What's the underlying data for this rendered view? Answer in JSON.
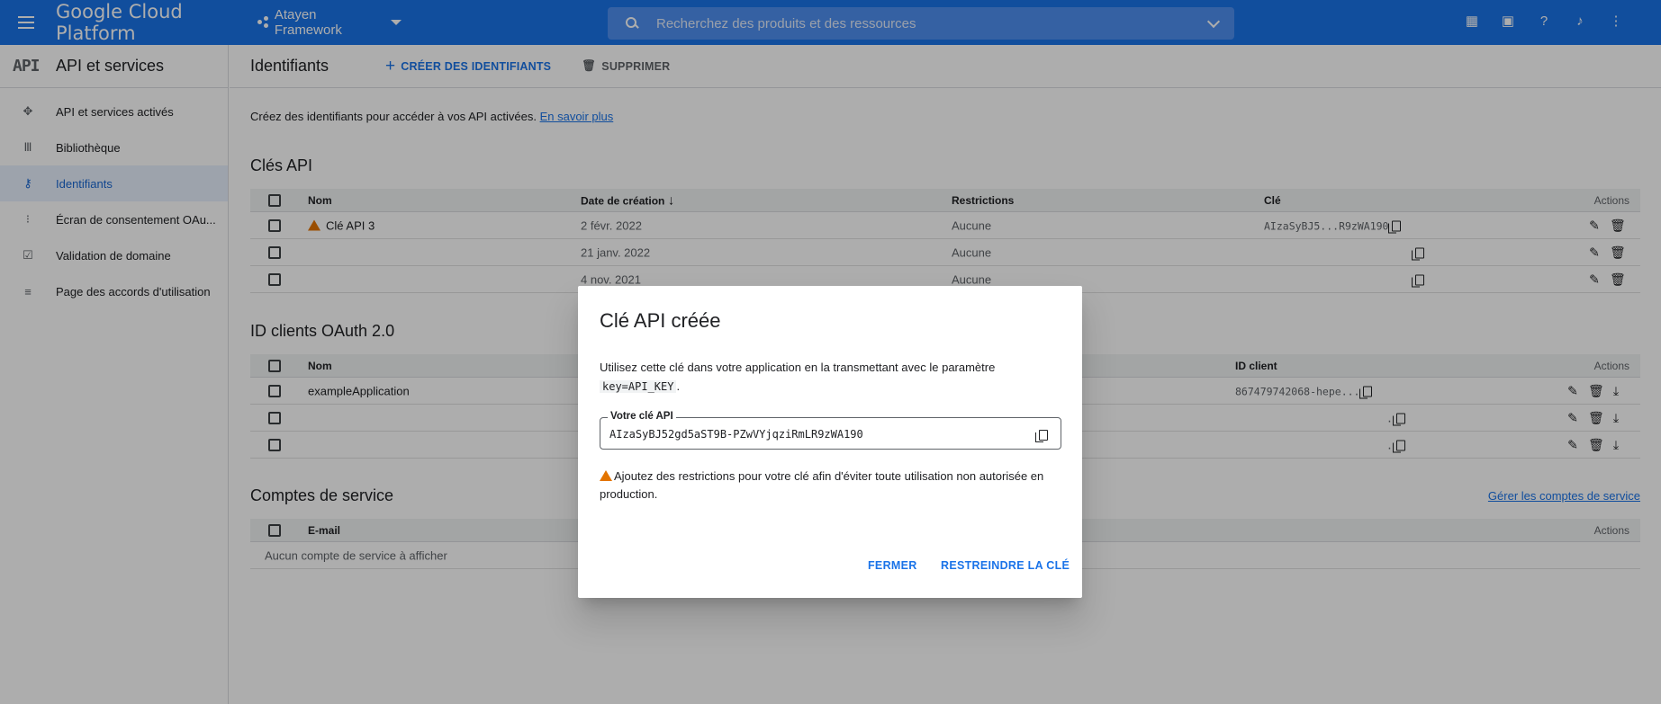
{
  "topbar": {
    "brand": "Google Cloud Platform",
    "project": "Atayen Framework",
    "search_placeholder": "Recherchez des produits et des ressources",
    "icons": [
      "gift-icon",
      "terminal-icon",
      "help-icon",
      "bell-icon",
      "more-vert-icon"
    ]
  },
  "sidebar": {
    "logo": "API",
    "title": "API et services",
    "items": [
      {
        "label": "API et services activés",
        "icon": "diamond-nodes-icon"
      },
      {
        "label": "Bibliothèque",
        "icon": "library-icon"
      },
      {
        "label": "Identifiants",
        "icon": "key-icon",
        "active": true
      },
      {
        "label": "Écran de consentement OAu...",
        "icon": "consent-icon"
      },
      {
        "label": "Validation de domaine",
        "icon": "checkbox-icon"
      },
      {
        "label": "Page des accords d'utilisation",
        "icon": "settings-list-icon"
      }
    ]
  },
  "toolbar": {
    "title": "Identifiants",
    "create_label": "CRÉER DES IDENTIFIANTS",
    "delete_label": "SUPPRIMER"
  },
  "intro": {
    "text": "Créez des identifiants pour accéder à vos API activées.",
    "link": "En savoir plus"
  },
  "api_keys": {
    "title": "Clés API",
    "headers": {
      "name": "Nom",
      "date": "Date de création",
      "restrictions": "Restrictions",
      "key": "Clé",
      "actions": "Actions"
    },
    "rows": [
      {
        "name": "Clé API 3",
        "date": "2 févr. 2022",
        "restrictions": "Aucune",
        "key": "AIzaSyBJ5...R9zWA190"
      },
      {
        "name": "",
        "date": "21 janv. 2022",
        "restrictions": "Aucune",
        "key": ""
      },
      {
        "name": "",
        "date": "4 nov. 2021",
        "restrictions": "Aucune",
        "key": ""
      }
    ]
  },
  "oauth": {
    "title": "ID clients OAuth 2.0",
    "headers": {
      "name": "Nom",
      "client_id": "ID client",
      "actions": "Actions"
    },
    "rows": [
      {
        "name": "exampleApplication",
        "client_id": "867479742068-hepe..."
      },
      {
        "name": "",
        "client_id": "."
      },
      {
        "name": "",
        "client_id": "."
      }
    ]
  },
  "service_accounts": {
    "title": "Comptes de service",
    "manage_link": "Gérer les comptes de service",
    "headers": {
      "email": "E-mail",
      "actions": "Actions"
    },
    "empty": "Aucun compte de service à afficher"
  },
  "dialog": {
    "title": "Clé API créée",
    "text_before": "Utilisez cette clé dans votre application en la transmettant avec le paramètre",
    "param": "key=API_KEY",
    "text_after": ".",
    "field_label": "Votre clé API",
    "key_value": "AIzaSyBJ52gd5aST9B-PZwVYjqziRmLR9zWA190",
    "warning": "Ajoutez des restrictions pour votre clé afin d'éviter toute utilisation non autorisée en production.",
    "close_label": "FERMER",
    "restrict_label": "RESTREINDRE LA CLÉ"
  },
  "colors": {
    "primary": "#1a73e8",
    "warning": "#e37400",
    "overlay": "rgba(0,0,0,0.32)"
  }
}
